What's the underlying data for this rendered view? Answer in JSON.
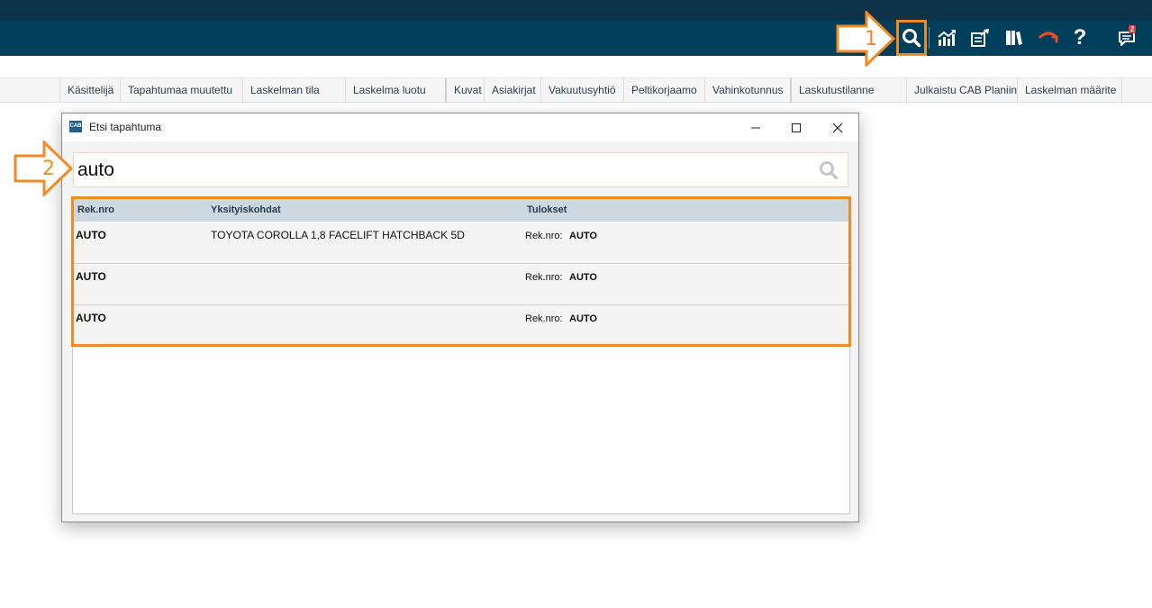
{
  "colors": {
    "appbar": "#003f5c",
    "topstrip": "#0e3248",
    "accent_orange": "#f08a24",
    "badge": "#e53935",
    "phone_red": "#e8502a"
  },
  "toolbar": {
    "icons": [
      "search-icon",
      "chart-icon",
      "export-icon",
      "book-icon",
      "phone-hangup-icon",
      "help-icon",
      "notifications-icon"
    ],
    "help_label": "?",
    "notification_count": "2"
  },
  "annotations": {
    "step1": "1",
    "step2": "2"
  },
  "columns": [
    "Käsittelijä",
    "Tapahtumaa muutettu",
    "Laskelman tila",
    "Laskelma luotu",
    "Kuvat",
    "Asiakirjat",
    "Vakuutusyhtiö",
    "Peltikorjaamo",
    "Vahinkotunnus",
    "Laskutustilanne",
    "Julkaistu CAB Planiin",
    "Laskelman määrite"
  ],
  "dialog": {
    "logo": "CAB",
    "title": "Etsi tapahtuma",
    "search_value": "auto",
    "result_headers": {
      "reg": "Rek.nro",
      "details": "Yksityiskohdat",
      "results": "Tulokset"
    },
    "rows": [
      {
        "reg": "AUTO",
        "details": "TOYOTA COROLLA 1,8 FACELIFT HATCHBACK 5D",
        "result_label": "Rek.nro:",
        "result_value": "AUTO"
      },
      {
        "reg": "AUTO",
        "details": "",
        "result_label": "Rek.nro:",
        "result_value": "AUTO"
      },
      {
        "reg": "AUTO",
        "details": "",
        "result_label": "Rek.nro:",
        "result_value": "AUTO"
      }
    ]
  }
}
